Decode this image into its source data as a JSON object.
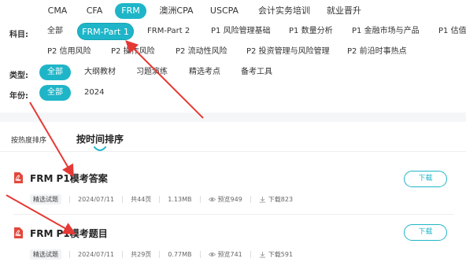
{
  "top_tabs": [
    {
      "label": "CMA",
      "active": false
    },
    {
      "label": "CFA",
      "active": false
    },
    {
      "label": "FRM",
      "active": true
    },
    {
      "label": "澳洲CPA",
      "active": false
    },
    {
      "label": "USCPA",
      "active": false
    },
    {
      "label": "会计实务培训",
      "active": false
    },
    {
      "label": "就业晋升",
      "active": false
    }
  ],
  "subject": {
    "label": "科目:",
    "items": [
      {
        "label": "全部",
        "active": false
      },
      {
        "label": "FRM-Part 1",
        "active": true
      },
      {
        "label": "FRM-Part 2",
        "active": false
      },
      {
        "label": "P1 风险管理基础",
        "active": false
      },
      {
        "label": "P1 数量分析",
        "active": false
      },
      {
        "label": "P1 金融市场与产品",
        "active": false
      },
      {
        "label": "P1 估值",
        "active": false
      },
      {
        "label": "P2 信用风险",
        "active": false
      },
      {
        "label": "P2 操作风险",
        "active": false
      },
      {
        "label": "P2 流动性风险",
        "active": false
      },
      {
        "label": "P2 投资管理与风险管理",
        "active": false
      },
      {
        "label": "P2 前沿时事热点",
        "active": false
      }
    ]
  },
  "type": {
    "label": "类型:",
    "items": [
      {
        "label": "全部",
        "active": true
      },
      {
        "label": "大纲教材",
        "active": false
      },
      {
        "label": "习题演练",
        "active": false
      },
      {
        "label": "精选考点",
        "active": false
      },
      {
        "label": "备考工具",
        "active": false
      }
    ]
  },
  "year": {
    "label": "年份:",
    "items": [
      {
        "label": "全部",
        "active": true
      },
      {
        "label": "2024",
        "active": false
      }
    ]
  },
  "sort": {
    "by_popularity": "按热度排序",
    "by_time": "按时间排序"
  },
  "files": [
    {
      "title": "FRM P1模考答案",
      "tag": "精选试题",
      "date": "2024/07/11",
      "pages": "共44页",
      "size": "1.13MB",
      "views": "预览949",
      "downloads": "下载823",
      "button": "下载"
    },
    {
      "title": "FRM P1模考题目",
      "tag": "精选试题",
      "date": "2024/07/11",
      "pages": "共29页",
      "size": "0.77MB",
      "views": "预览741",
      "downloads": "下载591",
      "button": "下载"
    }
  ],
  "colors": {
    "accent": "#1fb5c8",
    "pdf": "#e2483b",
    "arrow": "#e53935"
  }
}
